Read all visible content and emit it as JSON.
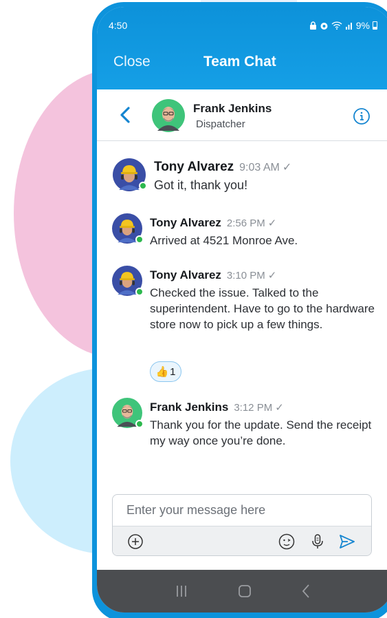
{
  "status_bar": {
    "time": "4:50",
    "battery": "9%"
  },
  "header": {
    "close_label": "Close",
    "title": "Team Chat"
  },
  "contact": {
    "name": "Frank Jenkins",
    "role": "Dispatcher"
  },
  "messages": [
    {
      "sender": "Tony Alvarez",
      "time": "9:03 AM",
      "text": "Got it, thank you!"
    },
    {
      "sender": "Tony Alvarez",
      "time": "2:56 PM",
      "text": "Arrived at 4521 Monroe Ave."
    },
    {
      "sender": "Tony Alvarez",
      "time": "3:10 PM",
      "text": "Checked the issue. Talked to the superintendent. Have to go to the hardware store now to pick up a  few things."
    },
    {
      "sender": "Frank Jenkins",
      "time": "3:12 PM",
      "text": "Thank you for the update. Send the receipt my way once you’re done."
    }
  ],
  "reaction": {
    "emoji": "👍",
    "count": "1"
  },
  "composer": {
    "placeholder": "Enter your message here"
  },
  "colors": {
    "accent": "#0d93dc",
    "online": "#2db84e",
    "blob_pink": "#f4c3dd",
    "blob_blue": "#cdeefd"
  },
  "icons": [
    "chevron-left-icon",
    "info-icon",
    "plus-circle-icon",
    "emoji-icon",
    "microphone-icon",
    "send-icon",
    "recents-icon",
    "home-icon",
    "back-icon"
  ]
}
